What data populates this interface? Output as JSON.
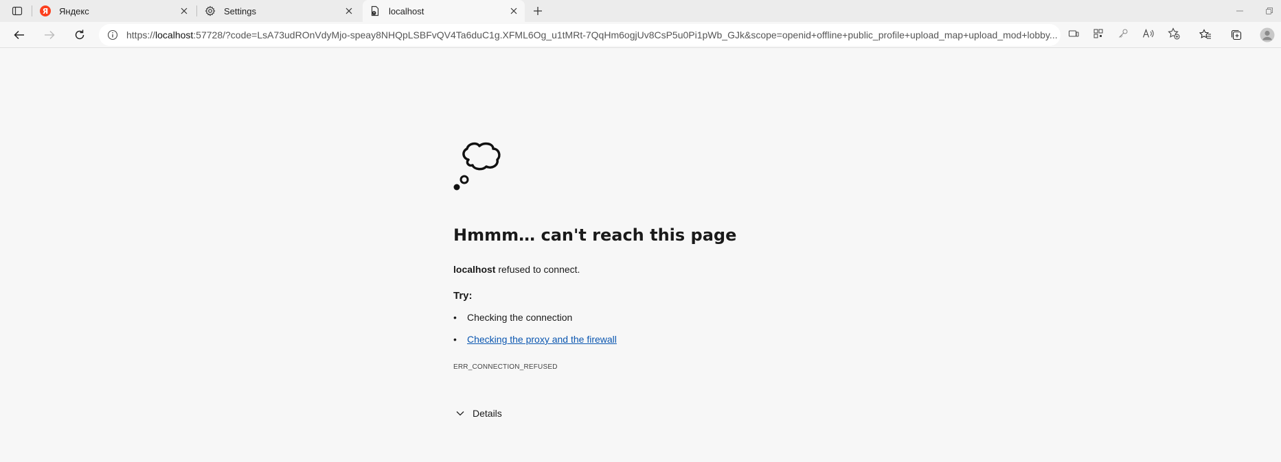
{
  "tabs": [
    {
      "title": "Яндекс",
      "icon": "yandex-logo",
      "favicon_text": "Я",
      "active": false
    },
    {
      "title": "Settings",
      "icon": "gear-icon",
      "active": false
    },
    {
      "title": "localhost",
      "icon": "page-error-icon",
      "active": true
    }
  ],
  "address_bar": {
    "url_prefix": "https://",
    "url_host": "localhost",
    "url_rest": ":57728/?code=LsA73udROnVdyMjo-speay8NHQpLSBFvQV4Ta6duC1g.XFML6Og_u1tMRt-7QqHm6ogjUv8CsP5u0Pi1pWb_GJk&scope=openid+offline+public_profile+upload_map+upload_mod+lobby..."
  },
  "error_page": {
    "heading": "Hmmm… can't reach this page",
    "host": "localhost",
    "message_rest": " refused to connect.",
    "try_label": "Try:",
    "suggestions": [
      "Checking the connection",
      "Checking the proxy and the firewall"
    ],
    "error_code": "ERR_CONNECTION_REFUSED",
    "details_label": "Details"
  },
  "colors": {
    "background": "#f7f7f7",
    "link": "#0a56b0",
    "yandex_red": "#fc3f1d"
  }
}
